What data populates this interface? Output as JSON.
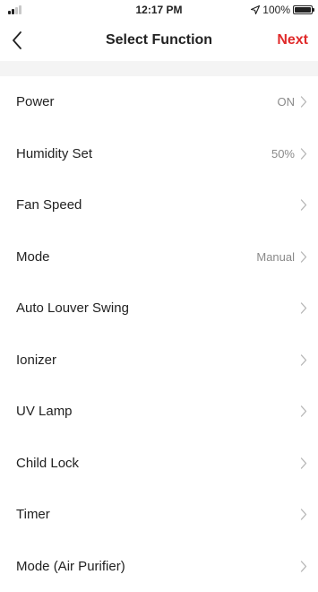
{
  "status_bar": {
    "time": "12:17 PM",
    "battery": "100%"
  },
  "nav": {
    "title": "Select Function",
    "next_label": "Next"
  },
  "colors": {
    "accent": "#e02a2a",
    "section_gap": "#f4f4f4",
    "value_text": "#8a8a8a"
  },
  "functions": [
    {
      "name": "Power",
      "value": "ON"
    },
    {
      "name": "Humidity Set",
      "value": "50%"
    },
    {
      "name": "Fan Speed",
      "value": ""
    },
    {
      "name": "Mode",
      "value": "Manual"
    },
    {
      "name": "Auto Louver Swing",
      "value": ""
    },
    {
      "name": "Ionizer",
      "value": ""
    },
    {
      "name": "UV Lamp",
      "value": ""
    },
    {
      "name": "Child Lock",
      "value": ""
    },
    {
      "name": "Timer",
      "value": ""
    },
    {
      "name": "Mode (Air Purifier)",
      "value": ""
    }
  ]
}
